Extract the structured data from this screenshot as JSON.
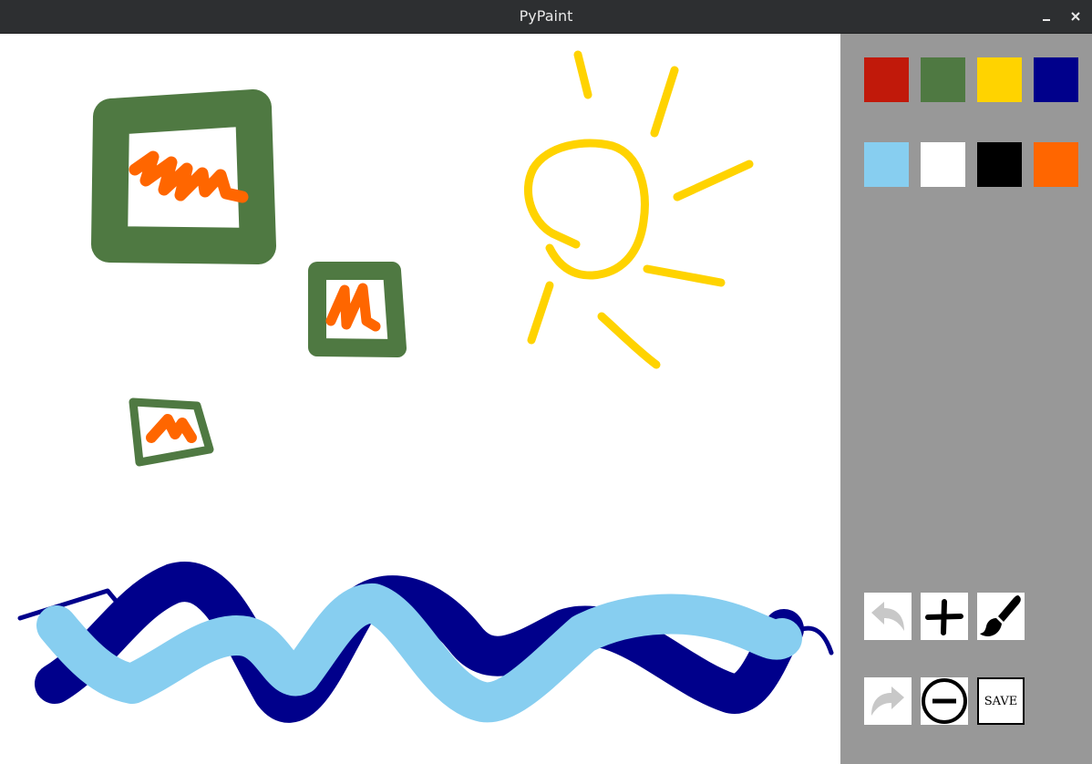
{
  "window": {
    "title": "PyPaint",
    "controls": [
      "minimize",
      "close"
    ]
  },
  "palette": {
    "colors": [
      {
        "name": "red",
        "hex": "#c1190a"
      },
      {
        "name": "green",
        "hex": "#4f7942"
      },
      {
        "name": "yellow",
        "hex": "#ffd300"
      },
      {
        "name": "navy",
        "hex": "#00008b"
      },
      {
        "name": "light-blue",
        "hex": "#87cef0"
      },
      {
        "name": "white",
        "hex": "#ffffff"
      },
      {
        "name": "black",
        "hex": "#000000"
      },
      {
        "name": "orange",
        "hex": "#ff6600"
      }
    ]
  },
  "tools": {
    "undo": {
      "icon": "undo-arrow-icon",
      "enabled": false
    },
    "redo": {
      "icon": "redo-arrow-icon",
      "enabled": false
    },
    "size_up": {
      "icon": "plus-icon"
    },
    "size_down": {
      "icon": "minus-circle-icon"
    },
    "brush": {
      "icon": "paintbrush-icon"
    },
    "save": {
      "label": "SAVE"
    }
  },
  "colors": {
    "titlebar": "#2d2f31",
    "sidebar": "#989898",
    "canvas": "#ffffff",
    "disabled_icon": "#c8c8c8"
  }
}
